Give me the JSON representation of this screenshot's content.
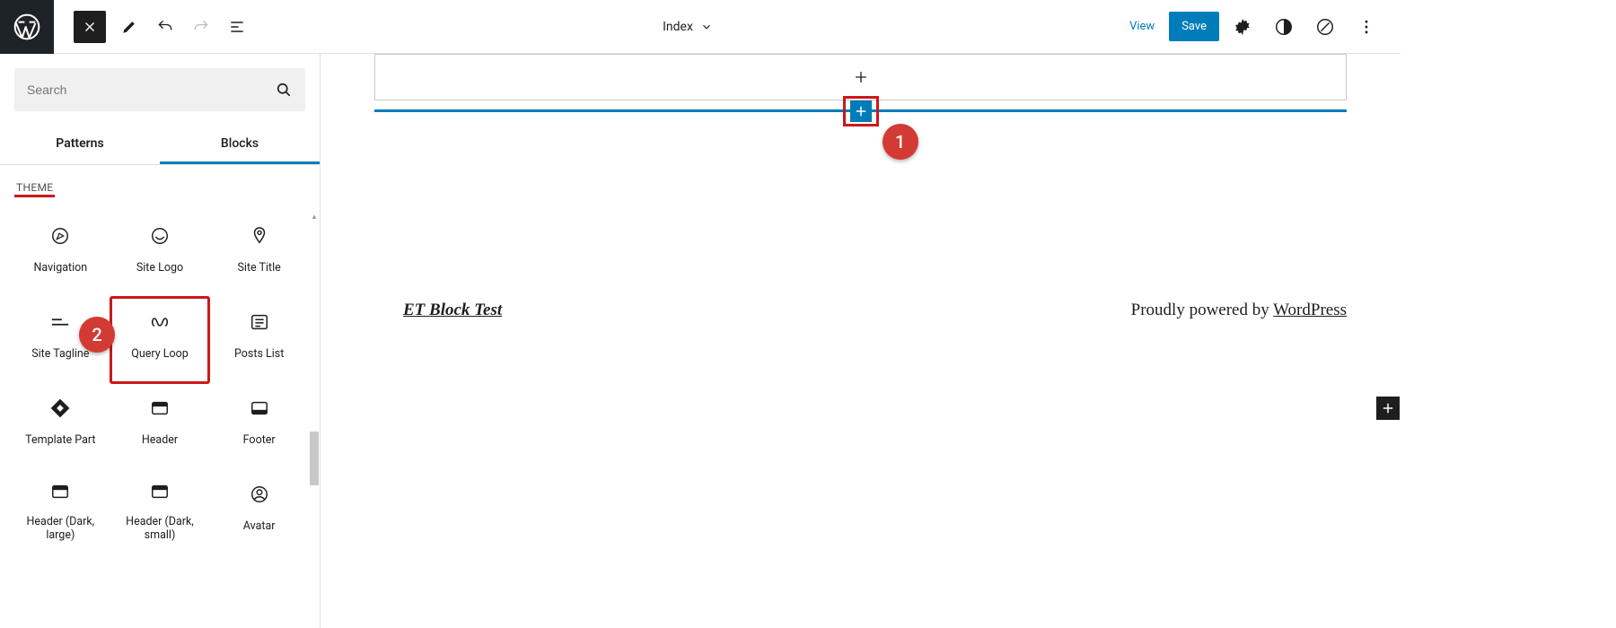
{
  "topbar": {
    "doc_title": "Index",
    "view_label": "View",
    "save_label": "Save"
  },
  "sidebar": {
    "search_placeholder": "Search",
    "tabs": {
      "patterns": "Patterns",
      "blocks": "Blocks",
      "active": "blocks"
    },
    "section_title": "THEME",
    "blocks": [
      {
        "label": "Navigation",
        "icon": "compass-icon"
      },
      {
        "label": "Site Logo",
        "icon": "smiley-icon"
      },
      {
        "label": "Site Title",
        "icon": "pin-icon"
      },
      {
        "label": "Site Tagline",
        "icon": "tagline-icon"
      },
      {
        "label": "Query Loop",
        "icon": "loop-icon"
      },
      {
        "label": "Posts List",
        "icon": "list-card-icon"
      },
      {
        "label": "Template Part",
        "icon": "template-part-icon"
      },
      {
        "label": "Header",
        "icon": "header-icon"
      },
      {
        "label": "Footer",
        "icon": "footer-icon"
      },
      {
        "label": "Header (Dark, large)",
        "icon": "header-dark-icon"
      },
      {
        "label": "Header (Dark, small)",
        "icon": "header-dark-icon"
      },
      {
        "label": "Avatar",
        "icon": "avatar-icon"
      }
    ]
  },
  "canvas": {
    "footer_site_title": "ET Block Test",
    "footer_powered": "Proudly powered by ",
    "footer_wp": "WordPress"
  },
  "annotations": {
    "callout1": "1",
    "callout2": "2"
  },
  "colors": {
    "accent": "#007cba",
    "annotation": "#cc1818"
  }
}
